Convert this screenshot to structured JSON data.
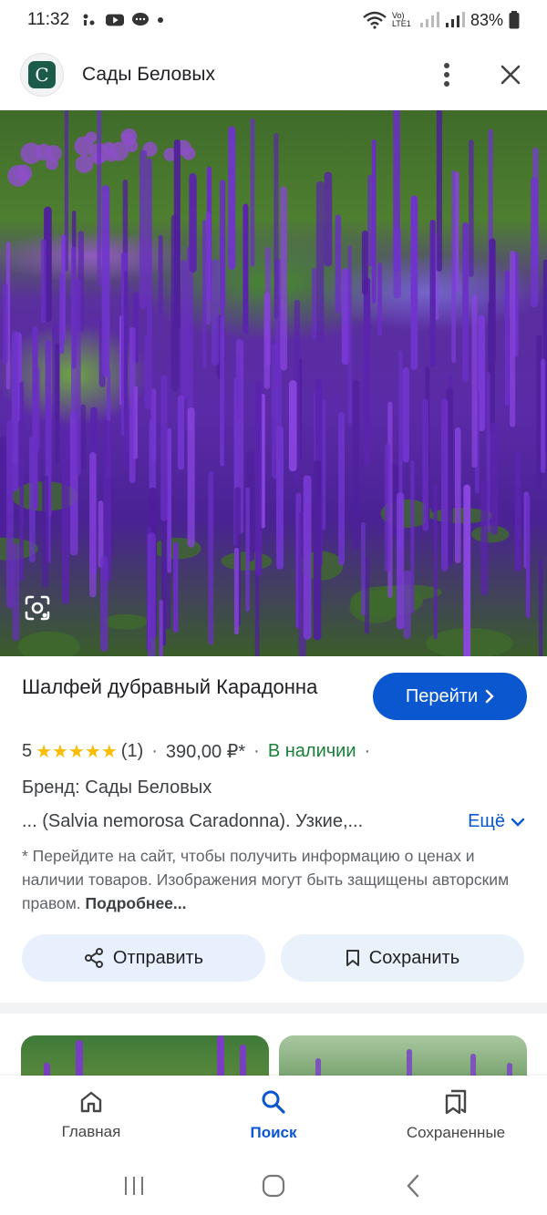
{
  "status_bar": {
    "time": "11:32",
    "network_label": "Vo) LTE1",
    "battery": "83%"
  },
  "header": {
    "site_name": "Сады Беловых",
    "logo_letter": "С",
    "menu_icon": "more-vert-icon",
    "close_icon": "close-icon"
  },
  "hero": {
    "description_icon": "lens-icon"
  },
  "product": {
    "title": "Шалфей дубравный Карадонна",
    "go_button_label": "Перейти",
    "rating_value": "5",
    "rating_stars": 5,
    "reviews_count": "(1)",
    "price": "390,00 ₽*",
    "stock_status": "В наличии",
    "brand": "Бренд: Сады Беловых",
    "description": "... (Salvia nemorosa Caradonna). Узкие,...",
    "more_label": "Ещё",
    "disclaimer": "* Перейдите на сайт, чтобы получить информацию о ценах и наличии товаров. Изображения могут быть защищены авторским правом.",
    "disclaimer_link": "Подробнее...",
    "share_label": "Отправить",
    "save_label": "Сохранить"
  },
  "bottom_nav": {
    "items": [
      {
        "label": "Главная",
        "icon": "home-icon",
        "active": false
      },
      {
        "label": "Поиск",
        "icon": "search-icon",
        "active": true
      },
      {
        "label": "Сохраненные",
        "icon": "bookmarks-icon",
        "active": false
      }
    ]
  },
  "colors": {
    "accent": "#0b57d0",
    "stock_green": "#188038",
    "star": "#fbbc04",
    "pill_bg": "#e8f0fe"
  }
}
